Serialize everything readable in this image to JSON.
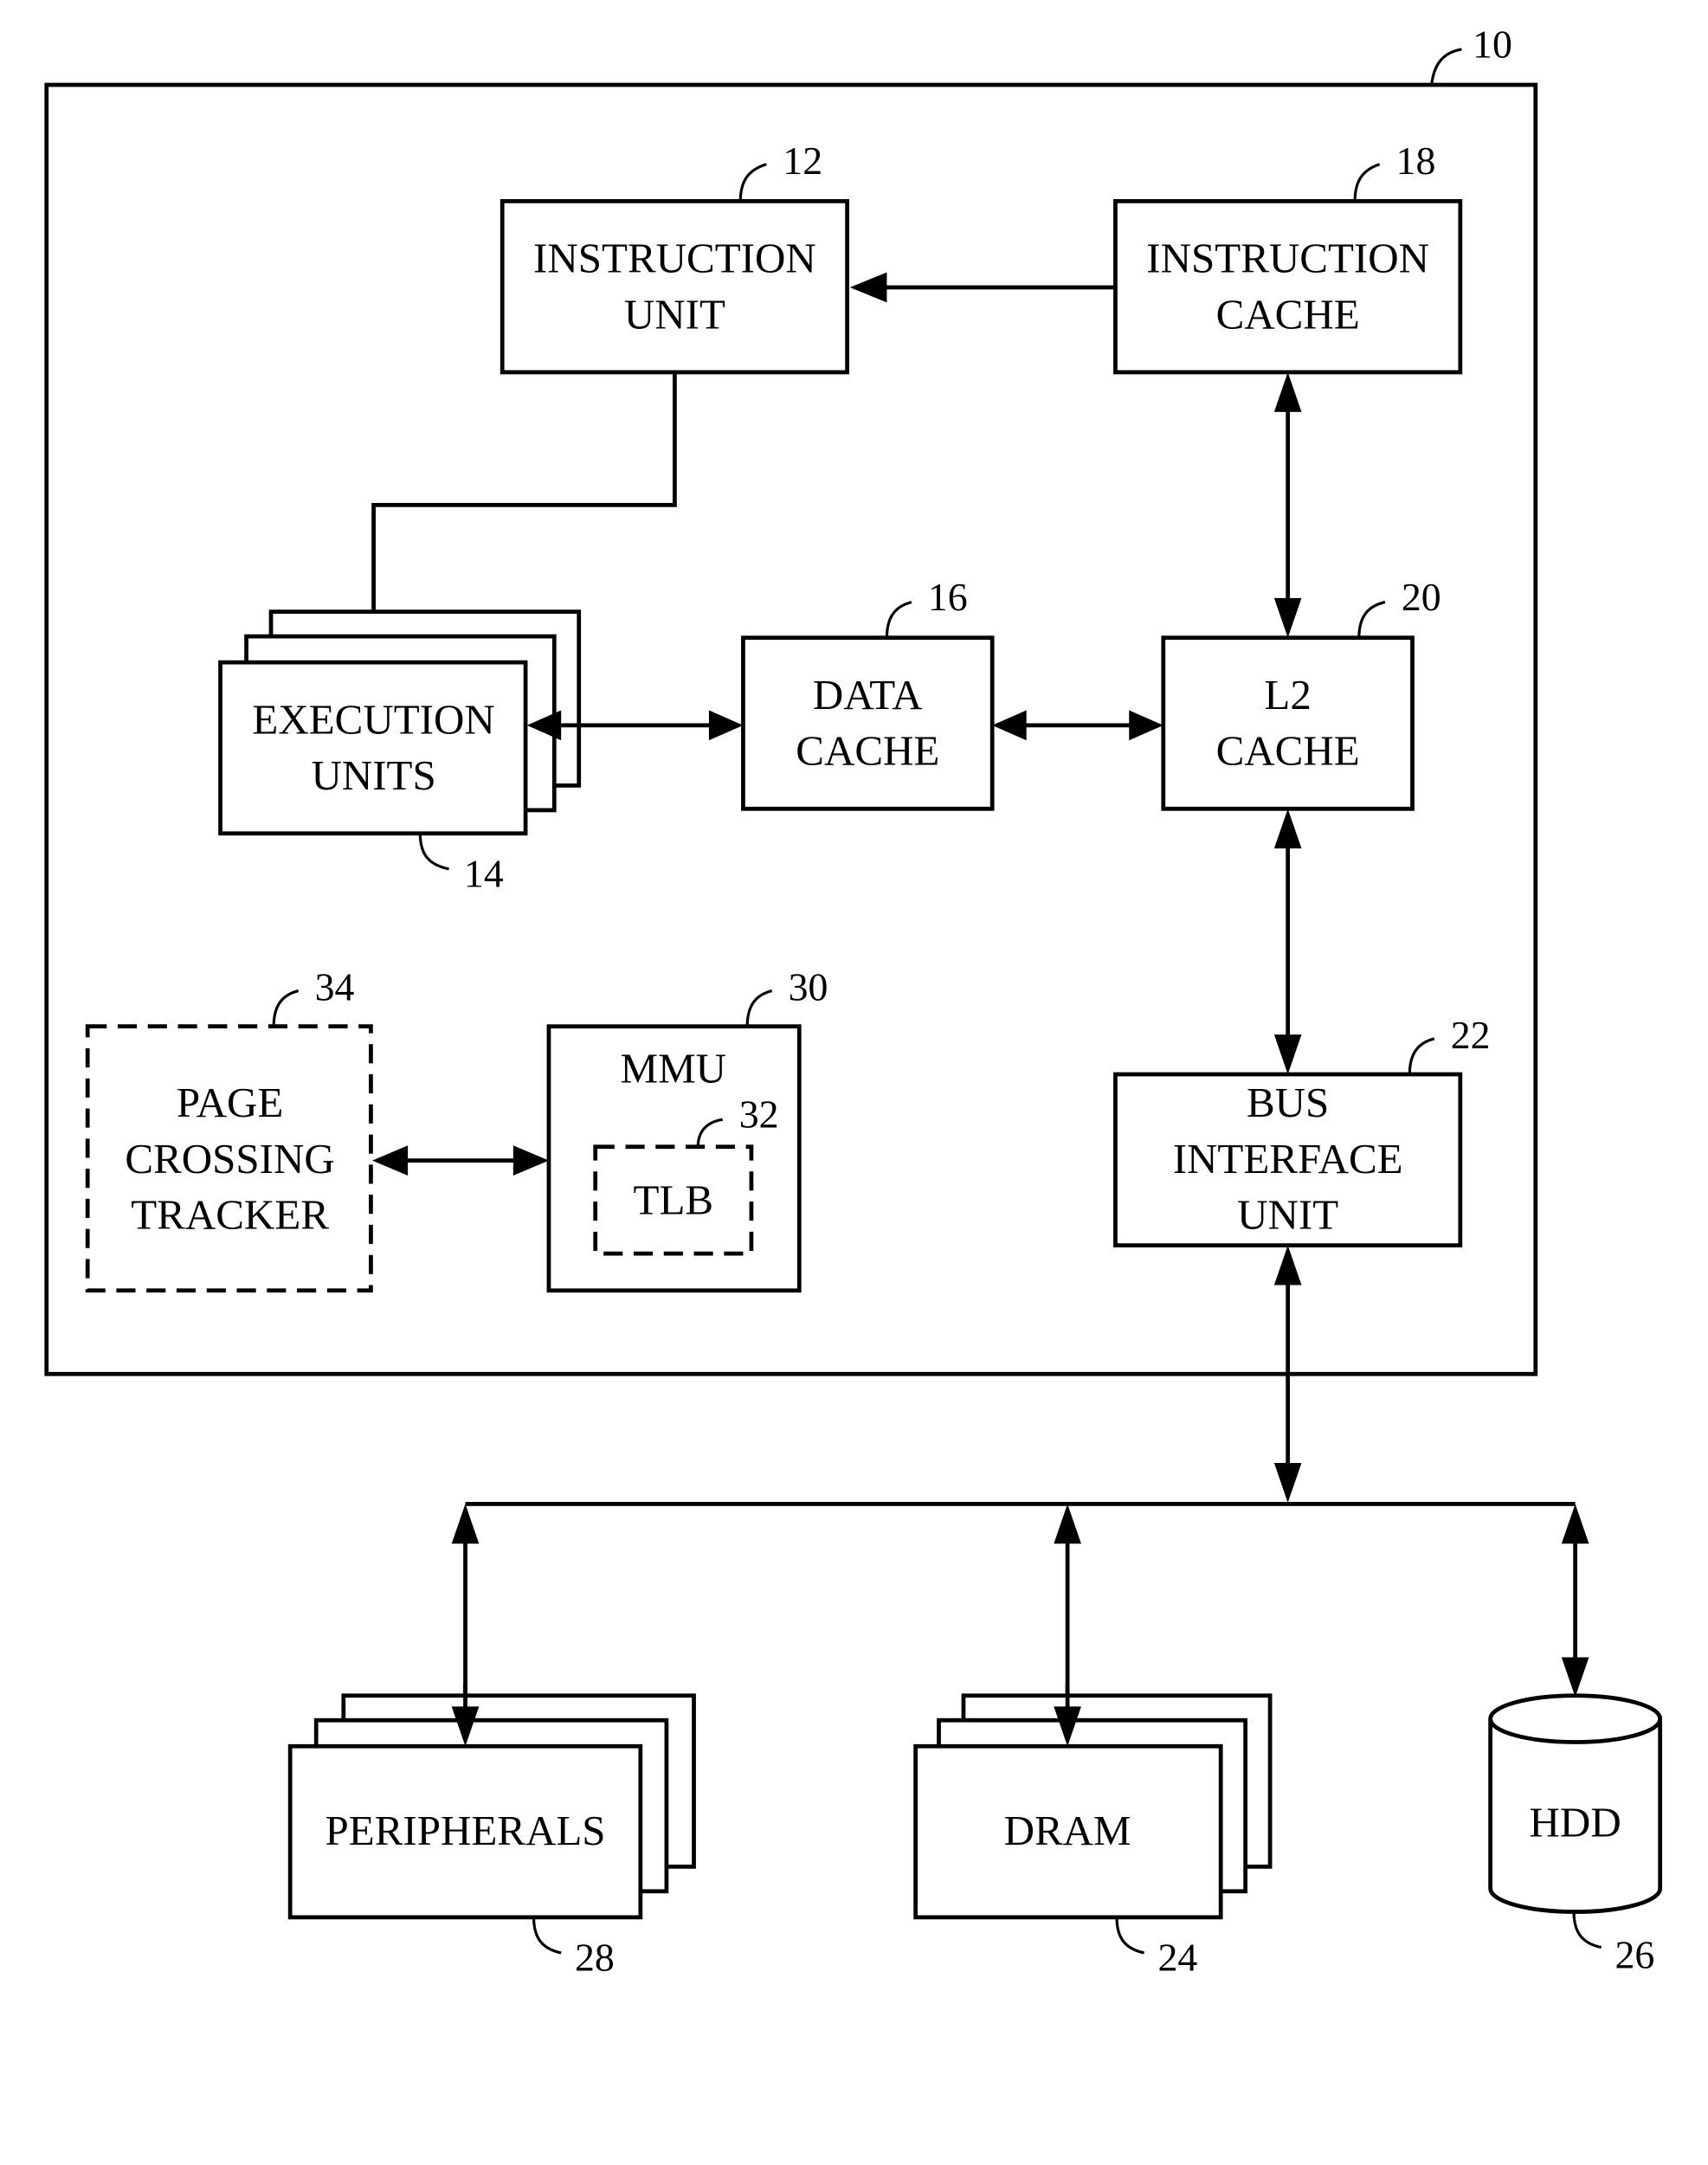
{
  "figure": {
    "system_ref": "10",
    "blocks": {
      "instruction_unit": {
        "lines": [
          "INSTRUCTION",
          "UNIT"
        ],
        "ref": "12"
      },
      "instruction_cache": {
        "lines": [
          "INSTRUCTION",
          "CACHE"
        ],
        "ref": "18"
      },
      "execution_units": {
        "lines": [
          "EXECUTION",
          "UNITS"
        ],
        "ref": "14"
      },
      "data_cache": {
        "lines": [
          "DATA",
          "CACHE"
        ],
        "ref": "16"
      },
      "l2_cache": {
        "lines": [
          "L2",
          "CACHE"
        ],
        "ref": "20"
      },
      "page_crossing_tracker": {
        "lines": [
          "PAGE",
          "CROSSING",
          "TRACKER"
        ],
        "ref": "34"
      },
      "mmu": {
        "lines": [
          "MMU"
        ],
        "ref": "30"
      },
      "tlb": {
        "lines": [
          "TLB"
        ],
        "ref": "32"
      },
      "bus_interface_unit": {
        "lines": [
          "BUS",
          "INTERFACE",
          "UNIT"
        ],
        "ref": "22"
      },
      "peripherals": {
        "lines": [
          "PERIPHERALS"
        ],
        "ref": "28"
      },
      "dram": {
        "lines": [
          "DRAM"
        ],
        "ref": "24"
      },
      "hdd": {
        "lines": [
          "HDD"
        ],
        "ref": "26"
      }
    }
  }
}
